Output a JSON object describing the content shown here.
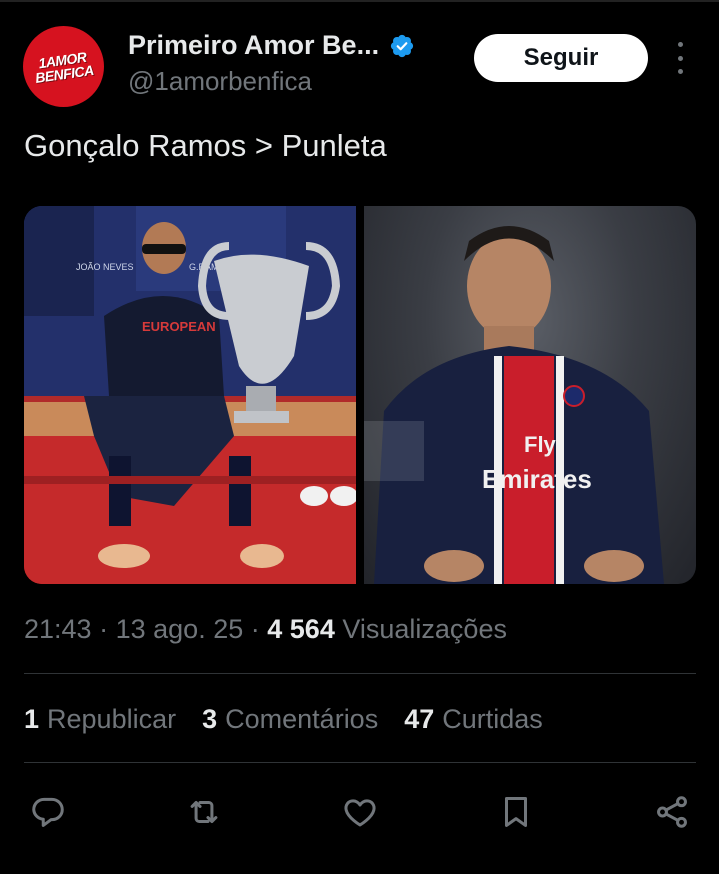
{
  "author": {
    "display_name": "Primeiro Amor Be...",
    "handle": "@1amorbenfica",
    "avatar_text_line1": "1AMOR",
    "avatar_text_line2": "BENFICA"
  },
  "follow_label": "Seguir",
  "tweet_text": "Gonçalo Ramos > Punleta",
  "media": [
    {
      "jersey_top": "EUROPEAN",
      "nameplate_1": "JOÃO NEVES",
      "nameplate_2": "G.RAMO"
    },
    {
      "sponsor_1": "Fly",
      "sponsor_2": "Emirates"
    }
  ],
  "meta": {
    "time": "21:43",
    "date": "13 ago. 25",
    "views": "4 564",
    "views_label": "Visualizações",
    "sep": "·"
  },
  "stats": {
    "reposts": "1",
    "reposts_label": "Republicar",
    "comments": "3",
    "comments_label": "Comentários",
    "likes": "47",
    "likes_label": "Curtidas"
  },
  "colors": {
    "background": "#000000",
    "text": "#e7e9ea",
    "secondary": "#71767b",
    "verified": "#1d9bf0",
    "benfica_red": "#d6121f"
  },
  "icons": [
    "verified-badge-icon",
    "more-dots-icon",
    "reply-icon",
    "repost-icon",
    "like-icon",
    "bookmark-icon",
    "share-icon"
  ]
}
